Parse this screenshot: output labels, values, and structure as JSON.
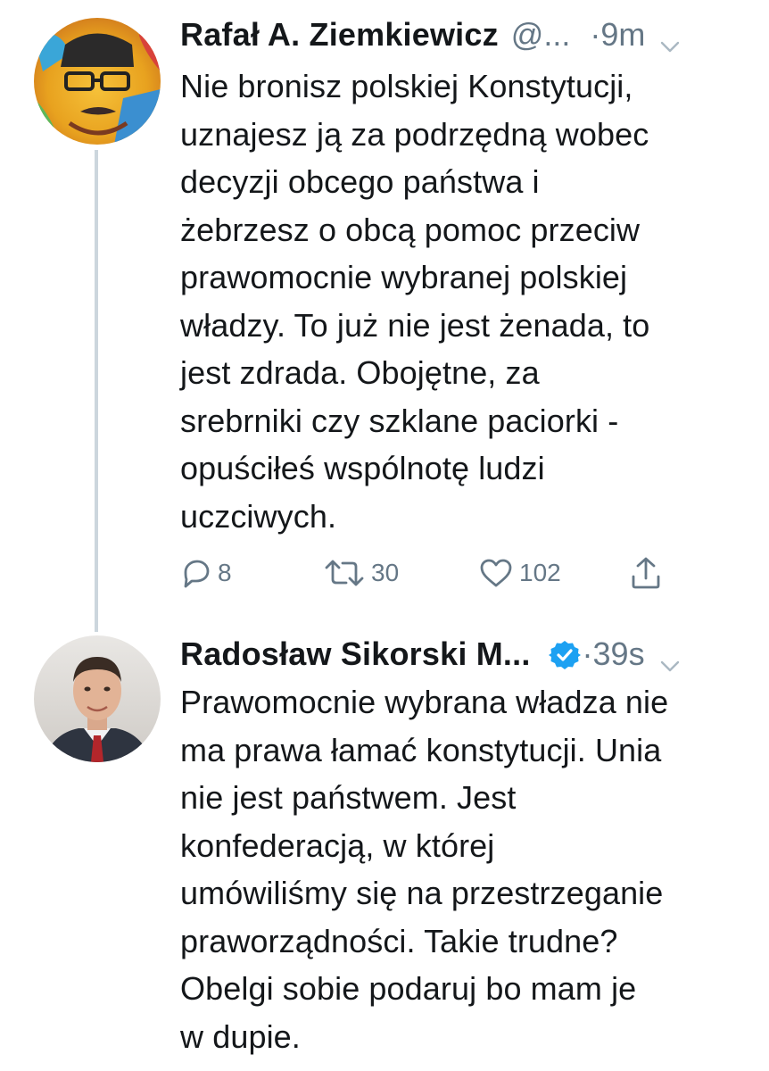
{
  "tweets": [
    {
      "author_name": "Rafał A. Ziemkiewicz",
      "handle": "@...",
      "time": "·9m",
      "text": "Nie bronisz polskiej Konstytucji,\nuznajesz ją za podrzędną wobec\ndecyzji obcego państwa i\nżebrzesz o obcą pomoc przeciw\nprawomocnie wybranej polskiej\nwładzy. To już nie jest żenada, to\njest zdrada. Obojętne, za\nsrebrniki czy szklane paciorki -\nopuściłeś wspólnotę ludzi\nuczciwych.",
      "replies": "8",
      "retweets": "30",
      "likes": "102"
    },
    {
      "author_name": "Radosław Sikorski M...",
      "time": "·39s",
      "verified": true,
      "text": "Prawomocnie wybrana władza nie\nma prawa łamać konstytucji. Unia\nnie jest państwem. Jest\nkonfederacją, w której\numówiliśmy się na przestrzeganie\npraworządności. Takie trudne?\nObelgi sobie podaruj bo mam je\nw dupie."
    }
  ],
  "icons": {
    "reply": "reply-icon",
    "retweet": "retweet-icon",
    "like": "heart-icon",
    "share": "share-icon",
    "verified": "verified-badge-icon",
    "menu": "chevron-down-icon"
  },
  "colors": {
    "text": "#14171a",
    "secondary": "#657786",
    "thread_line": "#ccd6dd",
    "verified": "#1da1f2"
  }
}
